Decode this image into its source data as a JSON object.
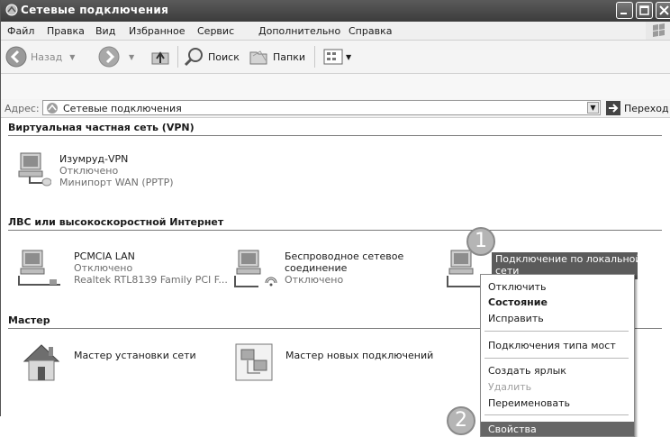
{
  "window": {
    "title": "Сетевые подключения"
  },
  "menubar": {
    "items": [
      "Файл",
      "Правка",
      "Вид",
      "Избранное",
      "Сервис",
      "Дополнительно",
      "Справка"
    ]
  },
  "toolbar": {
    "back": "Назад",
    "search": "Поиск",
    "folders": "Папки"
  },
  "address": {
    "label": "Адрес:",
    "value": "Сетевые подключения",
    "go": "Переход"
  },
  "groups": [
    {
      "title": "Виртуальная частная сеть (VPN)"
    },
    {
      "title": "ЛВС или высокоскоростной Интернет"
    },
    {
      "title": "Мастер"
    }
  ],
  "connections": {
    "vpn": {
      "name": "Изумруд-VPN",
      "status": "Отключено",
      "device": "Минипорт WAN (PPTP)"
    },
    "pcmcia": {
      "name": "PCMCIA LAN",
      "status": "Отключено",
      "device": "Realtek RTL8139 Family PCI F..."
    },
    "wireless": {
      "name1": "Беспроводное сетевое",
      "name2": "соединение",
      "status": "Отключено"
    },
    "local": {
      "name1": "Подключение по локальной",
      "name2": "сети"
    }
  },
  "wizards": {
    "setup": "Мастер установки сети",
    "new_conn": "Мастер новых подключений"
  },
  "context_menu": {
    "disable": "Отключить",
    "status": "Состояние",
    "repair": "Исправить",
    "bridge": "Подключения типа мост",
    "shortcut": "Создать ярлык",
    "delete": "Удалить",
    "rename": "Переименовать",
    "properties": "Свойства"
  },
  "badges": {
    "one": "1",
    "two": "2"
  }
}
